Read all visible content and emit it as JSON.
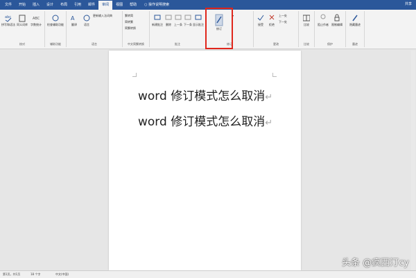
{
  "tabs": {
    "file": "文件",
    "start": "开始",
    "insert": "插入",
    "design": "设计",
    "layout": "布局",
    "references": "引用",
    "mailings": "邮件",
    "review": "审阅",
    "view": "视图",
    "help": "帮助",
    "tell_me": "操作说明搜索",
    "user": "共享"
  },
  "ribbon": {
    "spelling": "拼写和语法",
    "thesaurus": "同义词库",
    "word_count": "字数统计",
    "proofing_group": "校对",
    "check_accessibility": "检查辅助功能",
    "accessibility_group": "辅助功能",
    "translate": "翻译",
    "language": "语言",
    "update_ime": "更新输入法词典",
    "language_group": "语言",
    "trad_to_simp": "繁转简",
    "simp_to_trad": "简转繁",
    "convert": "简繁转换",
    "chinese_group": "中文简繁转换",
    "new_comment": "新建批注",
    "delete": "删除",
    "previous": "上一条",
    "next": "下一条",
    "show_comments": "显示批注",
    "comments_group": "批注",
    "track_changes": "修订",
    "tracking_group": "修订",
    "accept": "接受",
    "reject": "拒绝",
    "prev_change": "上一处",
    "next_change": "下一处",
    "changes_group": "更改",
    "compare": "比较",
    "compare_group": "比较",
    "block_authors": "阻止作者",
    "restrict_editing": "限制编辑",
    "protect_group": "保护",
    "hide_ink": "隐藏墨迹",
    "ink_group": "墨迹"
  },
  "document": {
    "line1": "word 修订模式怎么取消",
    "line2": "word 修订模式怎么取消",
    "paragraph_mark": "↵"
  },
  "status": {
    "page": "第1页，共1页",
    "words": "18 个字",
    "language": "中文(中国)"
  },
  "watermark": "头条 @疯西汀cy",
  "colors": {
    "titlebar": "#2b579a",
    "highlight_box": "#e0261b"
  }
}
